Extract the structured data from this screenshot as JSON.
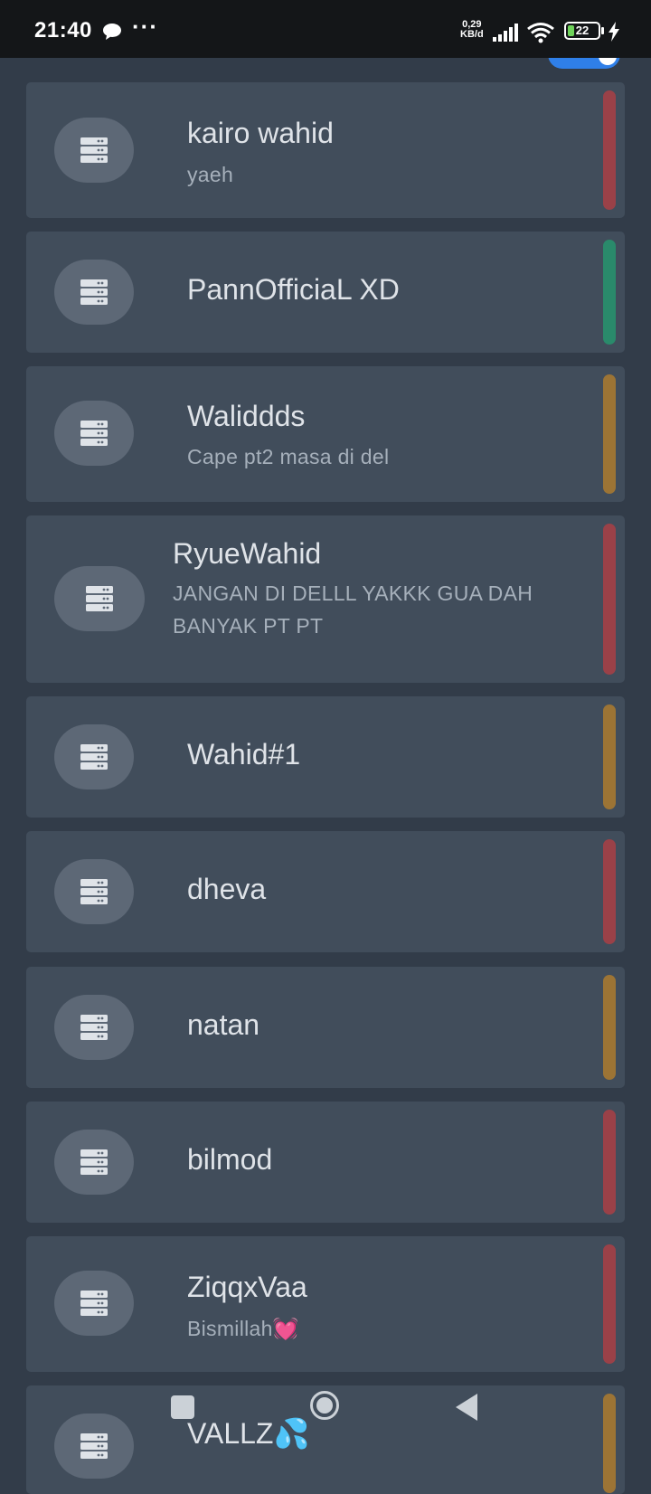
{
  "status_bar": {
    "time": "21:40",
    "more_dots": "···",
    "speed_value": "0,29",
    "speed_unit": "KB/d",
    "battery": "22"
  },
  "colors": {
    "red": "#9a4148",
    "green": "#2a8a6b",
    "amber": "#9c7435"
  },
  "items": [
    {
      "title": "kairo wahid",
      "subtitle": "yaeh",
      "status": "red"
    },
    {
      "title": "PannOfficiaL XD",
      "subtitle": "",
      "status": "green"
    },
    {
      "title": "Waliddds",
      "subtitle": "Cape pt2 masa di del",
      "status": "amber"
    },
    {
      "title": "RyueWahid",
      "subtitle": "JANGAN DI DELLL YAKKK GUA DAH BANYAK PT PT",
      "status": "red"
    },
    {
      "title": "Wahid#1",
      "subtitle": "",
      "status": "amber"
    },
    {
      "title": "dheva",
      "subtitle": "",
      "status": "red"
    },
    {
      "title": "natan",
      "subtitle": "",
      "status": "amber"
    },
    {
      "title": "bilmod",
      "subtitle": "",
      "status": "red"
    },
    {
      "title": "ZiqqxVaa",
      "subtitle": "Bismillah",
      "subtitle_emoji": "💓",
      "status": "red"
    },
    {
      "title": "VALLZ",
      "title_emoji": "💦",
      "subtitle": "",
      "status": "amber"
    }
  ]
}
